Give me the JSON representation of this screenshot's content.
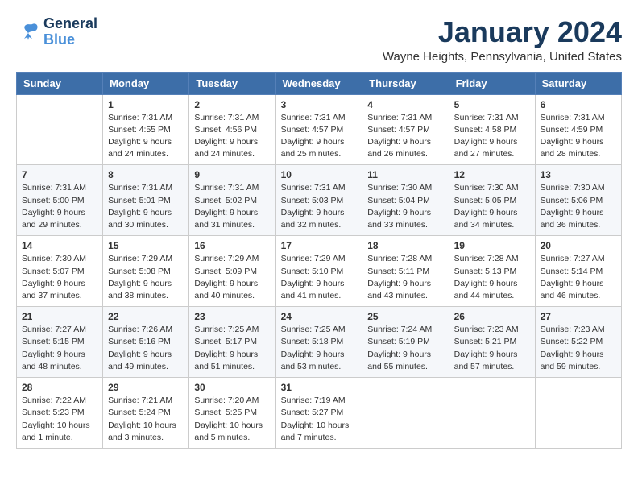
{
  "logo": {
    "text_general": "General",
    "text_blue": "Blue"
  },
  "title": "January 2024",
  "location": "Wayne Heights, Pennsylvania, United States",
  "headers": [
    "Sunday",
    "Monday",
    "Tuesday",
    "Wednesday",
    "Thursday",
    "Friday",
    "Saturday"
  ],
  "weeks": [
    [
      {
        "day": "",
        "sunrise": "",
        "sunset": "",
        "daylight": ""
      },
      {
        "day": "1",
        "sunrise": "Sunrise: 7:31 AM",
        "sunset": "Sunset: 4:55 PM",
        "daylight": "Daylight: 9 hours and 24 minutes."
      },
      {
        "day": "2",
        "sunrise": "Sunrise: 7:31 AM",
        "sunset": "Sunset: 4:56 PM",
        "daylight": "Daylight: 9 hours and 24 minutes."
      },
      {
        "day": "3",
        "sunrise": "Sunrise: 7:31 AM",
        "sunset": "Sunset: 4:57 PM",
        "daylight": "Daylight: 9 hours and 25 minutes."
      },
      {
        "day": "4",
        "sunrise": "Sunrise: 7:31 AM",
        "sunset": "Sunset: 4:57 PM",
        "daylight": "Daylight: 9 hours and 26 minutes."
      },
      {
        "day": "5",
        "sunrise": "Sunrise: 7:31 AM",
        "sunset": "Sunset: 4:58 PM",
        "daylight": "Daylight: 9 hours and 27 minutes."
      },
      {
        "day": "6",
        "sunrise": "Sunrise: 7:31 AM",
        "sunset": "Sunset: 4:59 PM",
        "daylight": "Daylight: 9 hours and 28 minutes."
      }
    ],
    [
      {
        "day": "7",
        "sunrise": "Sunrise: 7:31 AM",
        "sunset": "Sunset: 5:00 PM",
        "daylight": "Daylight: 9 hours and 29 minutes."
      },
      {
        "day": "8",
        "sunrise": "Sunrise: 7:31 AM",
        "sunset": "Sunset: 5:01 PM",
        "daylight": "Daylight: 9 hours and 30 minutes."
      },
      {
        "day": "9",
        "sunrise": "Sunrise: 7:31 AM",
        "sunset": "Sunset: 5:02 PM",
        "daylight": "Daylight: 9 hours and 31 minutes."
      },
      {
        "day": "10",
        "sunrise": "Sunrise: 7:31 AM",
        "sunset": "Sunset: 5:03 PM",
        "daylight": "Daylight: 9 hours and 32 minutes."
      },
      {
        "day": "11",
        "sunrise": "Sunrise: 7:30 AM",
        "sunset": "Sunset: 5:04 PM",
        "daylight": "Daylight: 9 hours and 33 minutes."
      },
      {
        "day": "12",
        "sunrise": "Sunrise: 7:30 AM",
        "sunset": "Sunset: 5:05 PM",
        "daylight": "Daylight: 9 hours and 34 minutes."
      },
      {
        "day": "13",
        "sunrise": "Sunrise: 7:30 AM",
        "sunset": "Sunset: 5:06 PM",
        "daylight": "Daylight: 9 hours and 36 minutes."
      }
    ],
    [
      {
        "day": "14",
        "sunrise": "Sunrise: 7:30 AM",
        "sunset": "Sunset: 5:07 PM",
        "daylight": "Daylight: 9 hours and 37 minutes."
      },
      {
        "day": "15",
        "sunrise": "Sunrise: 7:29 AM",
        "sunset": "Sunset: 5:08 PM",
        "daylight": "Daylight: 9 hours and 38 minutes."
      },
      {
        "day": "16",
        "sunrise": "Sunrise: 7:29 AM",
        "sunset": "Sunset: 5:09 PM",
        "daylight": "Daylight: 9 hours and 40 minutes."
      },
      {
        "day": "17",
        "sunrise": "Sunrise: 7:29 AM",
        "sunset": "Sunset: 5:10 PM",
        "daylight": "Daylight: 9 hours and 41 minutes."
      },
      {
        "day": "18",
        "sunrise": "Sunrise: 7:28 AM",
        "sunset": "Sunset: 5:11 PM",
        "daylight": "Daylight: 9 hours and 43 minutes."
      },
      {
        "day": "19",
        "sunrise": "Sunrise: 7:28 AM",
        "sunset": "Sunset: 5:13 PM",
        "daylight": "Daylight: 9 hours and 44 minutes."
      },
      {
        "day": "20",
        "sunrise": "Sunrise: 7:27 AM",
        "sunset": "Sunset: 5:14 PM",
        "daylight": "Daylight: 9 hours and 46 minutes."
      }
    ],
    [
      {
        "day": "21",
        "sunrise": "Sunrise: 7:27 AM",
        "sunset": "Sunset: 5:15 PM",
        "daylight": "Daylight: 9 hours and 48 minutes."
      },
      {
        "day": "22",
        "sunrise": "Sunrise: 7:26 AM",
        "sunset": "Sunset: 5:16 PM",
        "daylight": "Daylight: 9 hours and 49 minutes."
      },
      {
        "day": "23",
        "sunrise": "Sunrise: 7:25 AM",
        "sunset": "Sunset: 5:17 PM",
        "daylight": "Daylight: 9 hours and 51 minutes."
      },
      {
        "day": "24",
        "sunrise": "Sunrise: 7:25 AM",
        "sunset": "Sunset: 5:18 PM",
        "daylight": "Daylight: 9 hours and 53 minutes."
      },
      {
        "day": "25",
        "sunrise": "Sunrise: 7:24 AM",
        "sunset": "Sunset: 5:19 PM",
        "daylight": "Daylight: 9 hours and 55 minutes."
      },
      {
        "day": "26",
        "sunrise": "Sunrise: 7:23 AM",
        "sunset": "Sunset: 5:21 PM",
        "daylight": "Daylight: 9 hours and 57 minutes."
      },
      {
        "day": "27",
        "sunrise": "Sunrise: 7:23 AM",
        "sunset": "Sunset: 5:22 PM",
        "daylight": "Daylight: 9 hours and 59 minutes."
      }
    ],
    [
      {
        "day": "28",
        "sunrise": "Sunrise: 7:22 AM",
        "sunset": "Sunset: 5:23 PM",
        "daylight": "Daylight: 10 hours and 1 minute."
      },
      {
        "day": "29",
        "sunrise": "Sunrise: 7:21 AM",
        "sunset": "Sunset: 5:24 PM",
        "daylight": "Daylight: 10 hours and 3 minutes."
      },
      {
        "day": "30",
        "sunrise": "Sunrise: 7:20 AM",
        "sunset": "Sunset: 5:25 PM",
        "daylight": "Daylight: 10 hours and 5 minutes."
      },
      {
        "day": "31",
        "sunrise": "Sunrise: 7:19 AM",
        "sunset": "Sunset: 5:27 PM",
        "daylight": "Daylight: 10 hours and 7 minutes."
      },
      {
        "day": "",
        "sunrise": "",
        "sunset": "",
        "daylight": ""
      },
      {
        "day": "",
        "sunrise": "",
        "sunset": "",
        "daylight": ""
      },
      {
        "day": "",
        "sunrise": "",
        "sunset": "",
        "daylight": ""
      }
    ]
  ]
}
